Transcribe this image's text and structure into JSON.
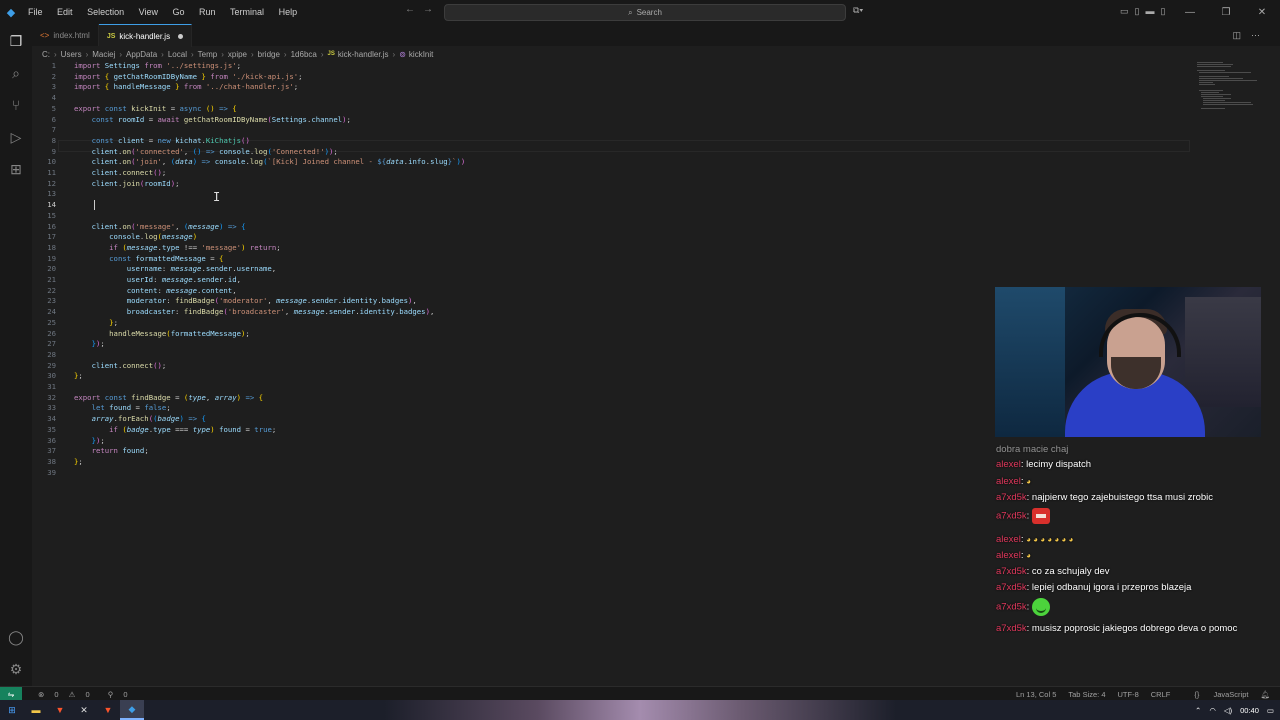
{
  "menu": [
    "File",
    "Edit",
    "Selection",
    "View",
    "Go",
    "Run",
    "Terminal",
    "Help"
  ],
  "search_placeholder": "Search",
  "tabs": [
    {
      "label": "index.html",
      "active": false
    },
    {
      "label": "kick-handler.js",
      "active": true,
      "modified": true
    }
  ],
  "breadcrumb": [
    "C:",
    "Users",
    "Maciej",
    "AppData",
    "Local",
    "Temp",
    "xpipe",
    "bridge",
    "1d6bca",
    "kick-handler.js",
    "kickInit"
  ],
  "status": {
    "errors": "0",
    "warnings": "0",
    "ports": "0",
    "position": "Ln 13, Col 5",
    "tab_size": "Tab Size: 4",
    "encoding": "UTF-8",
    "eol": "CRLF",
    "language": "JavaScript"
  },
  "taskbar": {
    "time": "00:40"
  },
  "chat": [
    {
      "user": "",
      "text": "dobra macie chaj"
    },
    {
      "user": "alexel",
      "text": "lecimy dispatch"
    },
    {
      "user": "alexel",
      "text": "",
      "emote": "small"
    },
    {
      "user": "a7xd5k",
      "text": "najpierw tego zajebuistego ttsa musi zrobic"
    },
    {
      "user": "a7xd5k",
      "text": "",
      "emote": "red"
    },
    {
      "user": "alexel",
      "text": "",
      "emote": "small-row"
    },
    {
      "user": "alexel",
      "text": "",
      "emote": "small"
    },
    {
      "user": "a7xd5k",
      "text": "co za schujaly dev"
    },
    {
      "user": "a7xd5k",
      "text": "lepiej odbanuj igora i przepros blazeja"
    },
    {
      "user": "a7xd5k",
      "text": "",
      "emote": "green"
    },
    {
      "user": "a7xd5k",
      "text": "musisz poprosic jakiegos dobrego deva o pomoc"
    }
  ],
  "colors": {
    "accent": "#3e9ee7",
    "status_remote": "#16825d",
    "chat_user": "#e0385c"
  }
}
